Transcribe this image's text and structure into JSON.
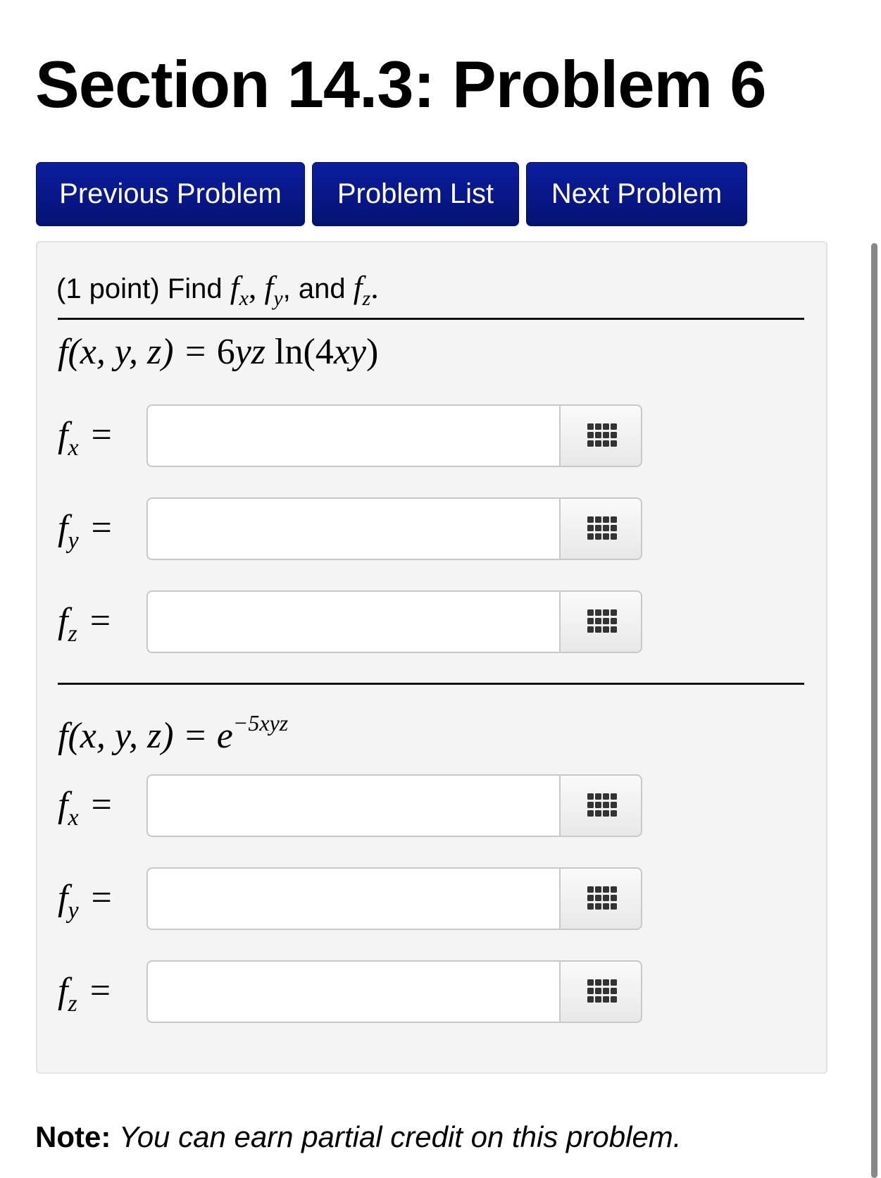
{
  "page_title": "Section 14.3: Problem 6",
  "nav": {
    "previous_label": "Previous Problem",
    "list_label": "Problem List",
    "next_label": "Next Problem"
  },
  "problem": {
    "intro_prefix": "(1 point) Find",
    "intro_f1": "f",
    "intro_sub1": "x",
    "intro_sep1": ",",
    "intro_f2": "f",
    "intro_sub2": "y",
    "intro_sep2": ", and",
    "intro_f3": "f",
    "intro_sub3": "z",
    "intro_end": ".",
    "part1": {
      "lhs": "f(x, y, z) = ",
      "coef": "6",
      "vars": "yz",
      "fn": "ln",
      "arg_open": "(4",
      "arg_vars": "xy",
      "arg_close": ")"
    },
    "part2": {
      "lhs": "f(x, y, z) = ",
      "base": "e",
      "exponent": "−5xyz"
    },
    "answer_rows": [
      {
        "f": "f",
        "sub": "x",
        "eq": "=",
        "value": ""
      },
      {
        "f": "f",
        "sub": "y",
        "eq": "=",
        "value": ""
      },
      {
        "f": "f",
        "sub": "z",
        "eq": "=",
        "value": ""
      },
      {
        "f": "f",
        "sub": "x",
        "eq": "=",
        "value": ""
      },
      {
        "f": "f",
        "sub": "y",
        "eq": "=",
        "value": ""
      },
      {
        "f": "f",
        "sub": "z",
        "eq": "=",
        "value": ""
      }
    ]
  },
  "note": {
    "label": "Note:",
    "text": "You can earn partial credit on this problem."
  },
  "icons": {
    "equation_editor": "grid-icon"
  },
  "colors": {
    "nav_button_bg": "#0a1b95",
    "well_bg": "#f4f4f4"
  }
}
